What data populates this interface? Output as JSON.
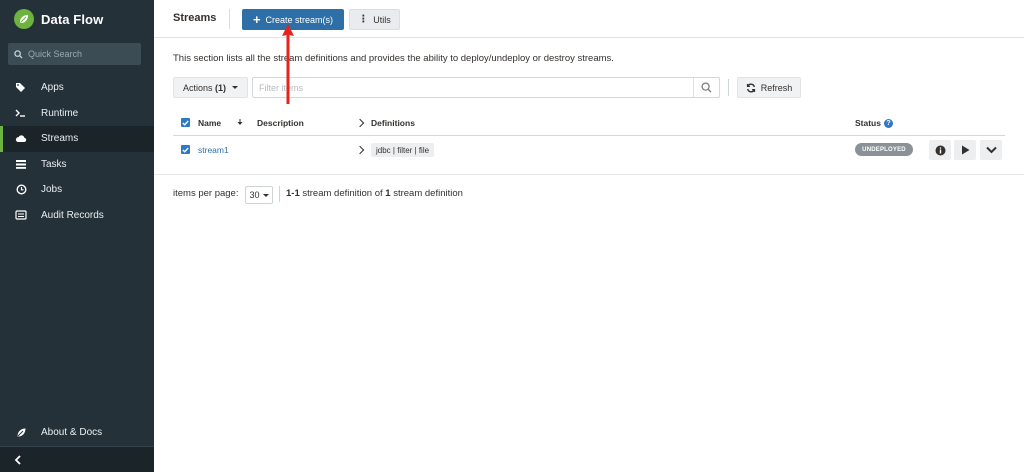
{
  "sidebar": {
    "app_title": "Data Flow",
    "search_placeholder": "Quick Search",
    "items": [
      {
        "label": "Apps",
        "icon": "tags-icon"
      },
      {
        "label": "Runtime",
        "icon": "terminal-icon"
      },
      {
        "label": "Streams",
        "icon": "cloud-icon",
        "active": true
      },
      {
        "label": "Tasks",
        "icon": "tasks-icon"
      },
      {
        "label": "Jobs",
        "icon": "clock-icon"
      },
      {
        "label": "Audit Records",
        "icon": "list-icon"
      }
    ],
    "about_label": "About & Docs"
  },
  "header": {
    "title": "Streams",
    "create_label": "Create stream(s)",
    "utils_label": "Utils"
  },
  "main": {
    "description": "This section lists all the stream definitions and provides the ability to deploy/undeploy or destroy streams.",
    "actions_label": "Actions",
    "actions_count": "(1)",
    "filter_placeholder": "Filter items",
    "refresh_label": "Refresh"
  },
  "table": {
    "columns": {
      "name": "Name",
      "description": "Description",
      "definitions": "Definitions",
      "status": "Status"
    },
    "rows": [
      {
        "name": "stream1",
        "description": "",
        "definition": "jdbc | filter | file",
        "status": "UNDEPLOYED",
        "checked": true
      }
    ]
  },
  "pagination": {
    "items_per_page_label": "items per page:",
    "items_per_page": "30",
    "range": "1-1",
    "range_text": "stream definition of",
    "total": "1",
    "total_text": "stream definition"
  },
  "colors": {
    "sidebar_bg": "#253138",
    "accent_green": "#6db33f",
    "primary_blue": "#2e6fa8",
    "status_gray": "#8a9297",
    "annotation_red": "#e8231b"
  }
}
